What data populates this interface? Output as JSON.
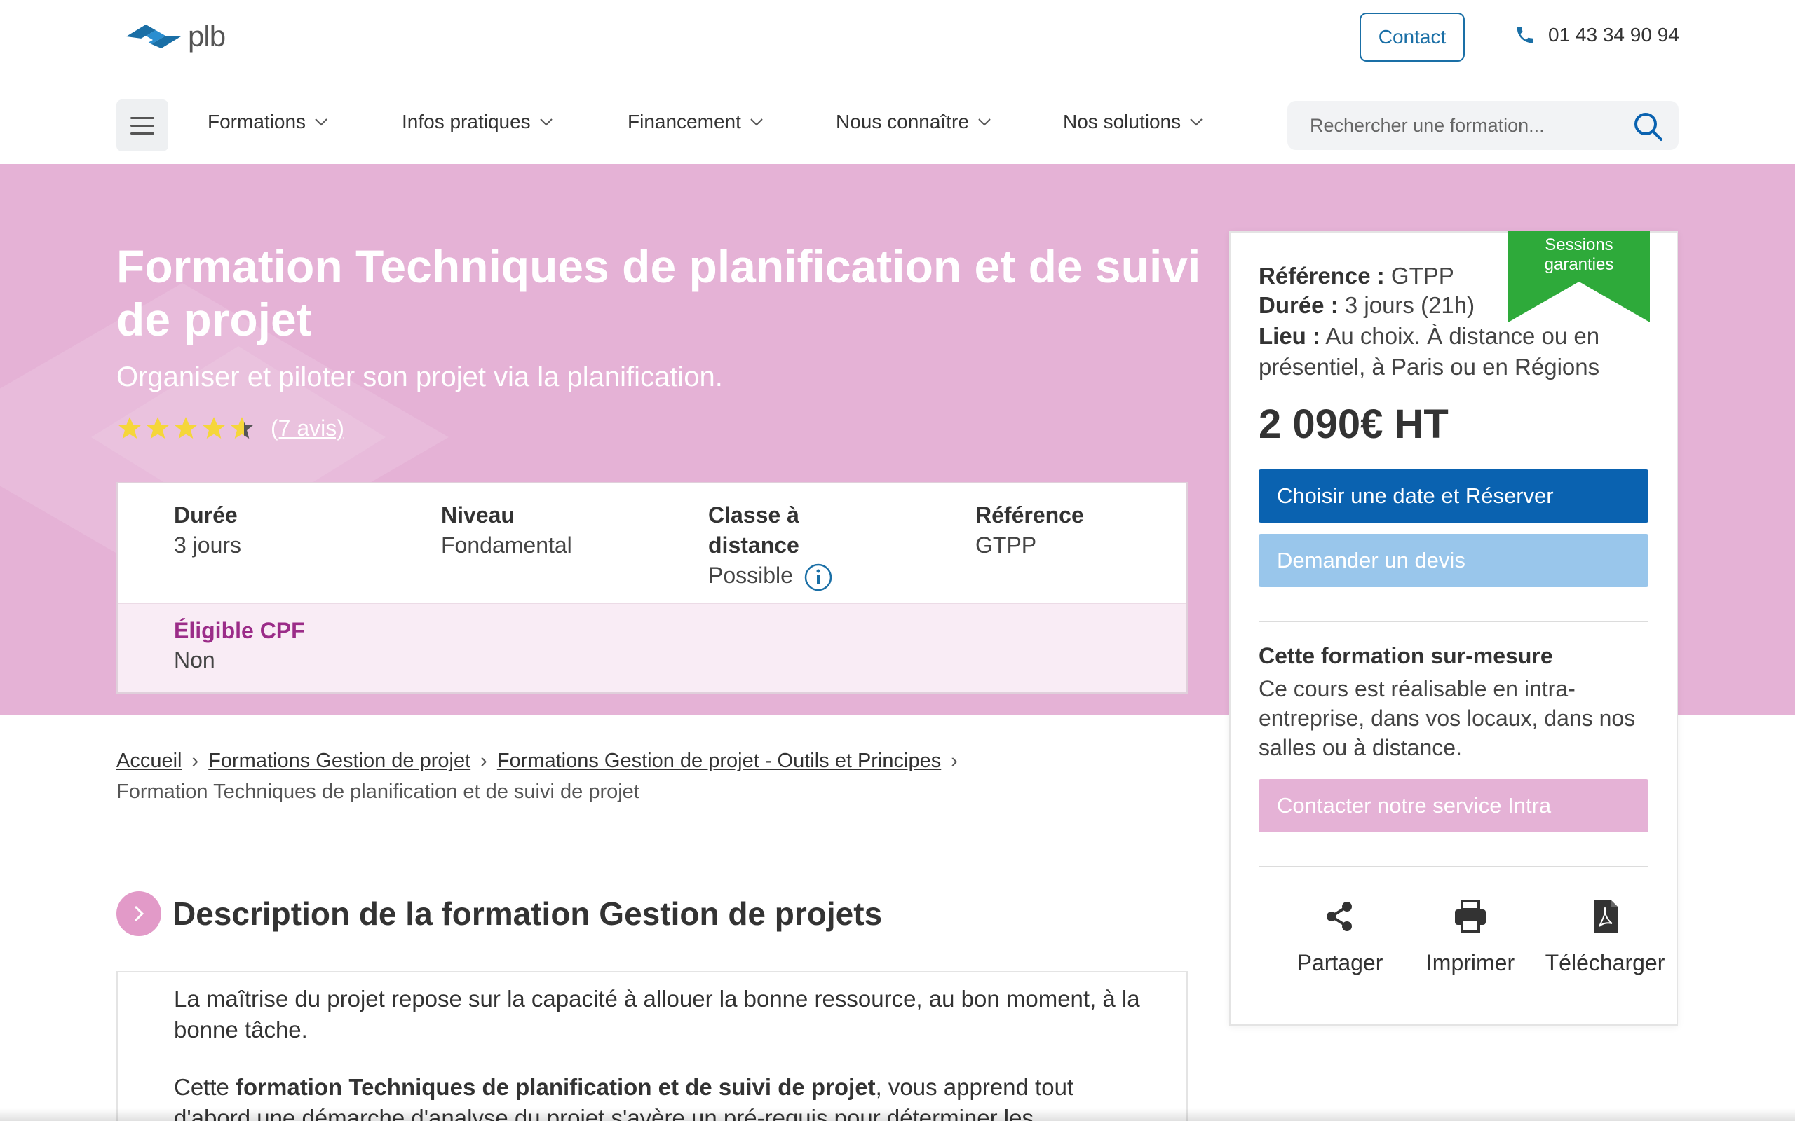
{
  "header": {
    "logo_text": "plb",
    "contact_label": "Contact",
    "phone": "01 43 34 90 94",
    "nav": [
      "Formations",
      "Infos pratiques",
      "Financement",
      "Nous connaître",
      "Nos solutions"
    ],
    "search_placeholder": "Rechercher une formation..."
  },
  "hero": {
    "title": "Formation Techniques de planification et de suivi de projet",
    "subtitle": "Organiser et piloter son projet via la planification.",
    "rating": 4.5,
    "reviews": "(7 avis)",
    "info": {
      "duree_label": "Durée",
      "duree_value": "3 jours",
      "niveau_label": "Niveau",
      "niveau_value": "Fondamental",
      "classe_label": "Classe à distance",
      "classe_value": "Possible",
      "ref_label": "Référence",
      "ref_value": "GTPP",
      "cpf_label": "Éligible CPF",
      "cpf_value": "Non"
    }
  },
  "breadcrumb": {
    "home": "Accueil",
    "level1": "Formations Gestion de projet",
    "level2": "Formations Gestion de projet - Outils et Principes",
    "current": "Formation Techniques de planification et de suivi de projet"
  },
  "description": {
    "title": "Description de la formation Gestion de projets",
    "p1": "La maîtrise du projet repose sur la capacité à allouer la bonne ressource, au bon moment, à la bonne tâche.",
    "p2_prefix": "Cette ",
    "p2_bold": "formation Techniques de planification et de suivi de projet",
    "p2_suffix": ", vous apprend tout d'abord une démarche d'analyse du projet s'avère un pré-requis pour déterminer les"
  },
  "sidebar": {
    "ribbon": "Sessions garanties",
    "ref_label": "Référence :",
    "ref_value": " GTPP",
    "duree_label": "Durée :",
    "duree_value": " 3 jours (21h)",
    "lieu_label": "Lieu :",
    "lieu_value": " Au choix. À distance ou en présentiel, à Paris ou en Régions",
    "price": "2 090€ HT",
    "btn_reserve": "Choisir une date et Réserver",
    "btn_devis": "Demander un devis",
    "custom_title": "Cette formation sur-mesure",
    "custom_text": "Ce cours est réalisable en intra-entreprise, dans vos locaux, dans nos salles ou à distance.",
    "btn_intra": "Contacter notre service Intra",
    "actions": [
      "Partager",
      "Imprimer",
      "Télécharger"
    ]
  },
  "colors": {
    "hero_bg": "#e5b2d6",
    "primary": "#0a62b0",
    "ribbon": "#2eaa3a",
    "cpf": "#9b2c88"
  }
}
